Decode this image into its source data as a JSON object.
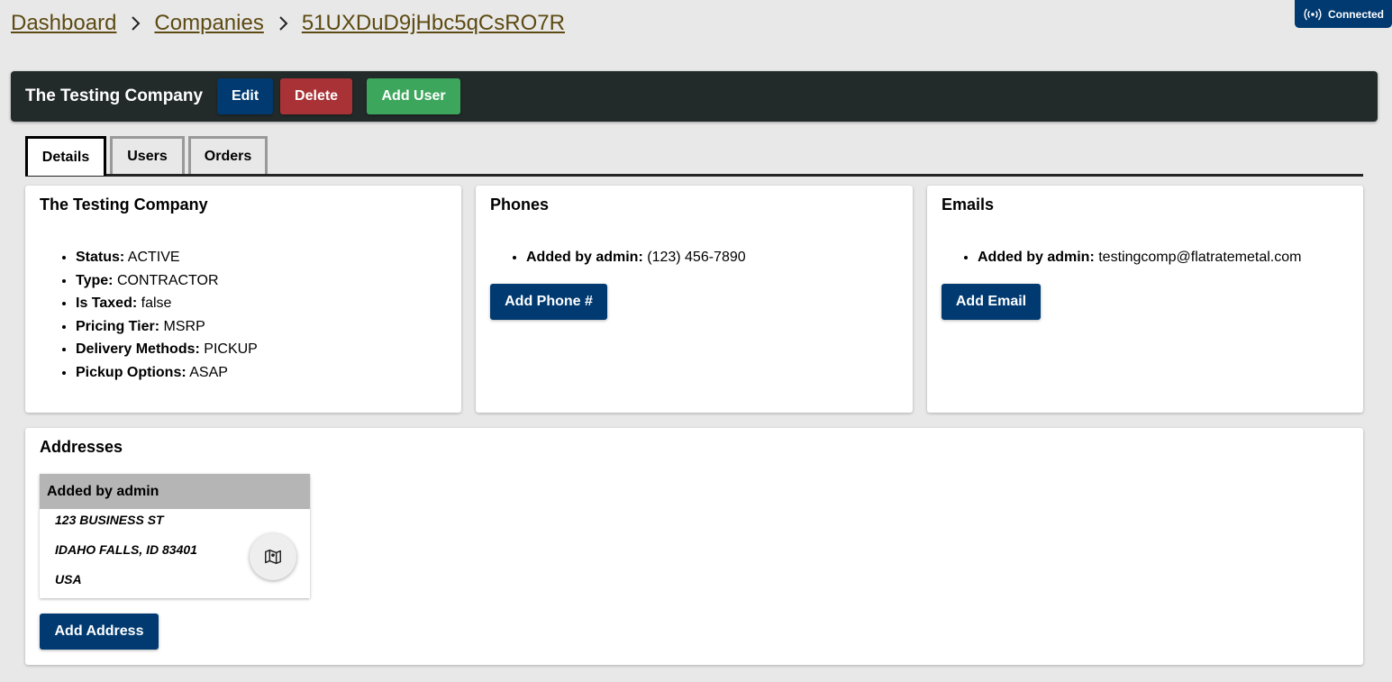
{
  "connection": {
    "label": "Connected",
    "icon": "broadcast-icon"
  },
  "breadcrumb": [
    "Dashboard",
    "Companies",
    "51UXDuD9jHbc5qCsRO7R"
  ],
  "header": {
    "title": "The Testing Company",
    "edit_label": "Edit",
    "delete_label": "Delete",
    "add_user_label": "Add User"
  },
  "tabs": [
    {
      "label": "Details",
      "active": true
    },
    {
      "label": "Users",
      "active": false
    },
    {
      "label": "Orders",
      "active": false
    }
  ],
  "details": {
    "title": "The Testing Company",
    "items": [
      {
        "key": "Status:",
        "value": "ACTIVE"
      },
      {
        "key": "Type:",
        "value": "CONTRACTOR"
      },
      {
        "key": "Is Taxed:",
        "value": "false"
      },
      {
        "key": "Pricing Tier:",
        "value": "MSRP"
      },
      {
        "key": "Delivery Methods:",
        "value": "PICKUP"
      },
      {
        "key": "Pickup Options:",
        "value": "ASAP"
      }
    ]
  },
  "phones": {
    "title": "Phones",
    "items": [
      {
        "key": "Added by admin:",
        "value": "(123) 456-7890"
      }
    ],
    "add_label": "Add Phone #"
  },
  "emails": {
    "title": "Emails",
    "items": [
      {
        "key": "Added by admin:",
        "value": "testingcomp@flatratemetal.com"
      }
    ],
    "add_label": "Add Email"
  },
  "addresses": {
    "title": "Addresses",
    "cards": [
      {
        "header": "Added by admin",
        "line1": "123 BUSINESS ST",
        "line2": "IDAHO FALLS, ID 83401",
        "line3": "USA",
        "map_icon": "map-icon"
      }
    ],
    "add_label": "Add Address"
  },
  "colors": {
    "primary": "#003a70",
    "danger": "#a83236",
    "success": "#3da65d",
    "header_bg": "#232a2a",
    "breadcrumb_link": "#5d4a12"
  }
}
